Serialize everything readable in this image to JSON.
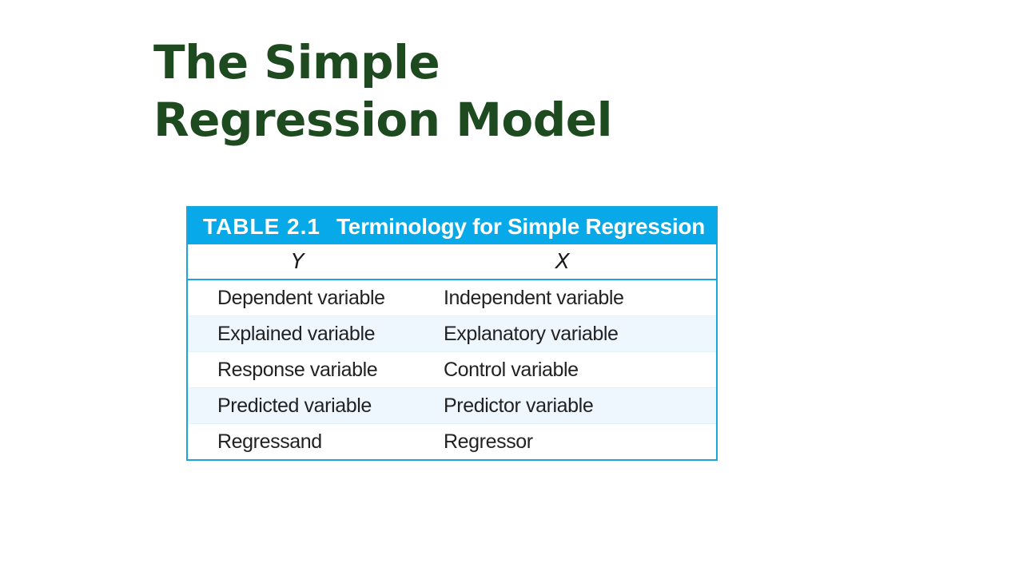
{
  "slide": {
    "title_line1": "The Simple",
    "title_line2": "Regression Model",
    "title_color": "#1e4a1f"
  },
  "table": {
    "caption_label": "TABLE 2.1",
    "caption_text": "Terminology for Simple Regression",
    "caption_bg": "#07a9e8",
    "border_color": "#1aa6dc",
    "headers": [
      "Y",
      "X"
    ],
    "rows": [
      [
        "Dependent variable",
        "Independent variable"
      ],
      [
        "Explained variable",
        "Explanatory variable"
      ],
      [
        "Response variable",
        "Control variable"
      ],
      [
        "Predicted variable",
        "Predictor variable"
      ],
      [
        "Regressand",
        "Regressor"
      ]
    ]
  }
}
